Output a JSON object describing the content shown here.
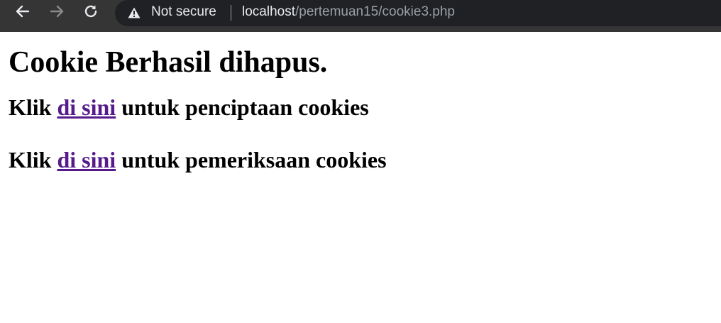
{
  "browser": {
    "security_label": "Not secure",
    "url_host": "localhost",
    "url_path": "/pertemuan15/cookie3.php",
    "icons": [
      "back-arrow-icon",
      "forward-arrow-icon",
      "reload-icon",
      "warning-icon"
    ]
  },
  "page": {
    "heading": "Cookie Berhasil dihapus.",
    "create_line": {
      "prefix": "Klik ",
      "link_text": "di sini",
      "suffix": " untuk penciptaan cookies"
    },
    "check_line": {
      "prefix": "Klik ",
      "link_text": "di sini",
      "suffix": " untuk pemeriksaan cookies"
    },
    "link_color": "#551a8b"
  }
}
